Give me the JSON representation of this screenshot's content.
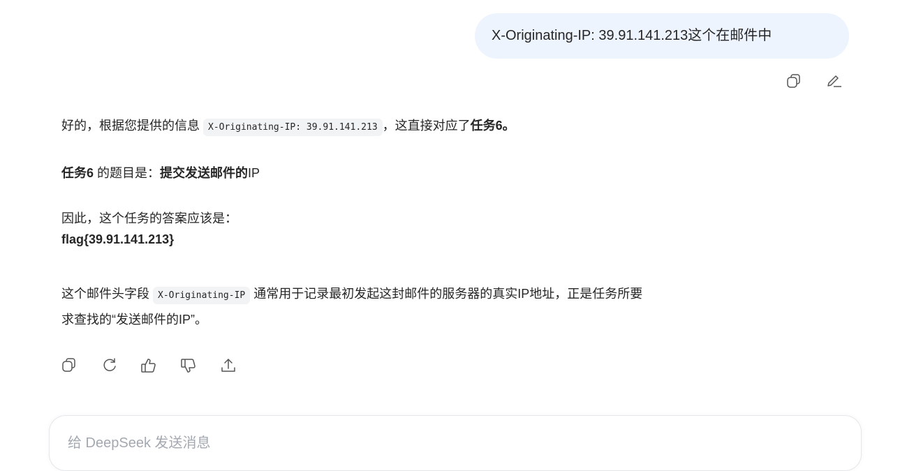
{
  "user_message": {
    "text": "X-Originating-IP: 39.91.141.213这个在邮件中"
  },
  "user_actions": {
    "copy_icon": "copy-icon",
    "edit_icon": "edit-icon"
  },
  "reply": {
    "p1": {
      "before": "好的，根据您提供的信息",
      "code": "X-Originating-IP: 39.91.141.213",
      "after": "，这直接对应了",
      "bold": "任务6。"
    },
    "p2": {
      "bold1": "任务6",
      "middle": "的题目是：",
      "bold2": "提交发送邮件的",
      "after": "IP"
    },
    "p3": {
      "line1": "因此，这个任务的答案应该是：",
      "flag": "flag{39.91.141.213}"
    },
    "p4": {
      "before": "这个邮件头字段",
      "code": "X-Originating-IP",
      "after": "通常用于记录最初发起这封邮件的服务器的真实IP地址，正是任务所要",
      "line2": "求查找的“发送邮件的IP”。"
    }
  },
  "reply_actions": [
    "copy-icon",
    "regenerate-icon",
    "thumbs-up-icon",
    "thumbs-down-icon",
    "share-icon"
  ],
  "composer": {
    "placeholder": "给 DeepSeek 发送消息"
  }
}
